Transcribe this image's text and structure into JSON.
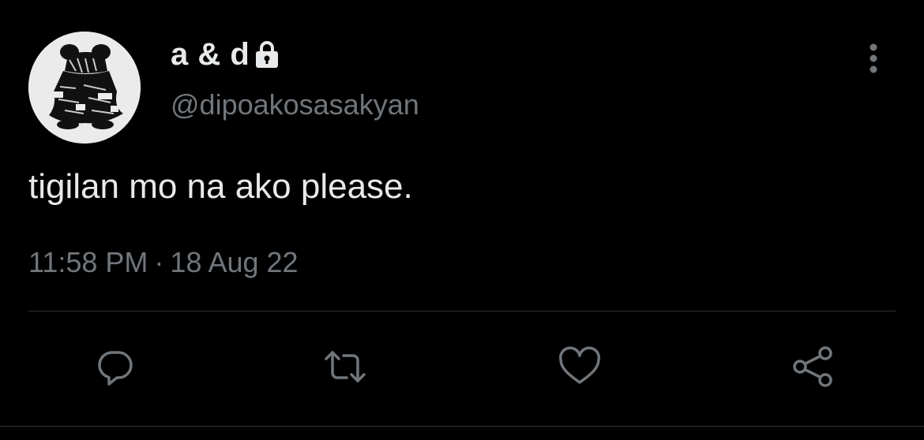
{
  "tweet": {
    "display_name": "a & d",
    "handle": "@dipoakosasakyan",
    "protected_icon": "lock-icon",
    "text": "tigilan mo na ako please.",
    "time": "11:58 PM",
    "separator": "·",
    "date": "18 Aug 22"
  },
  "actions": {
    "reply_icon": "reply-icon",
    "retweet_icon": "retweet-icon",
    "like_icon": "heart-icon",
    "share_icon": "share-icon",
    "more_icon": "more-vertical-icon"
  },
  "colors": {
    "background": "#000000",
    "primary_text": "#e7e9ea",
    "secondary_text": "#71767b",
    "divider": "#2f3336"
  }
}
